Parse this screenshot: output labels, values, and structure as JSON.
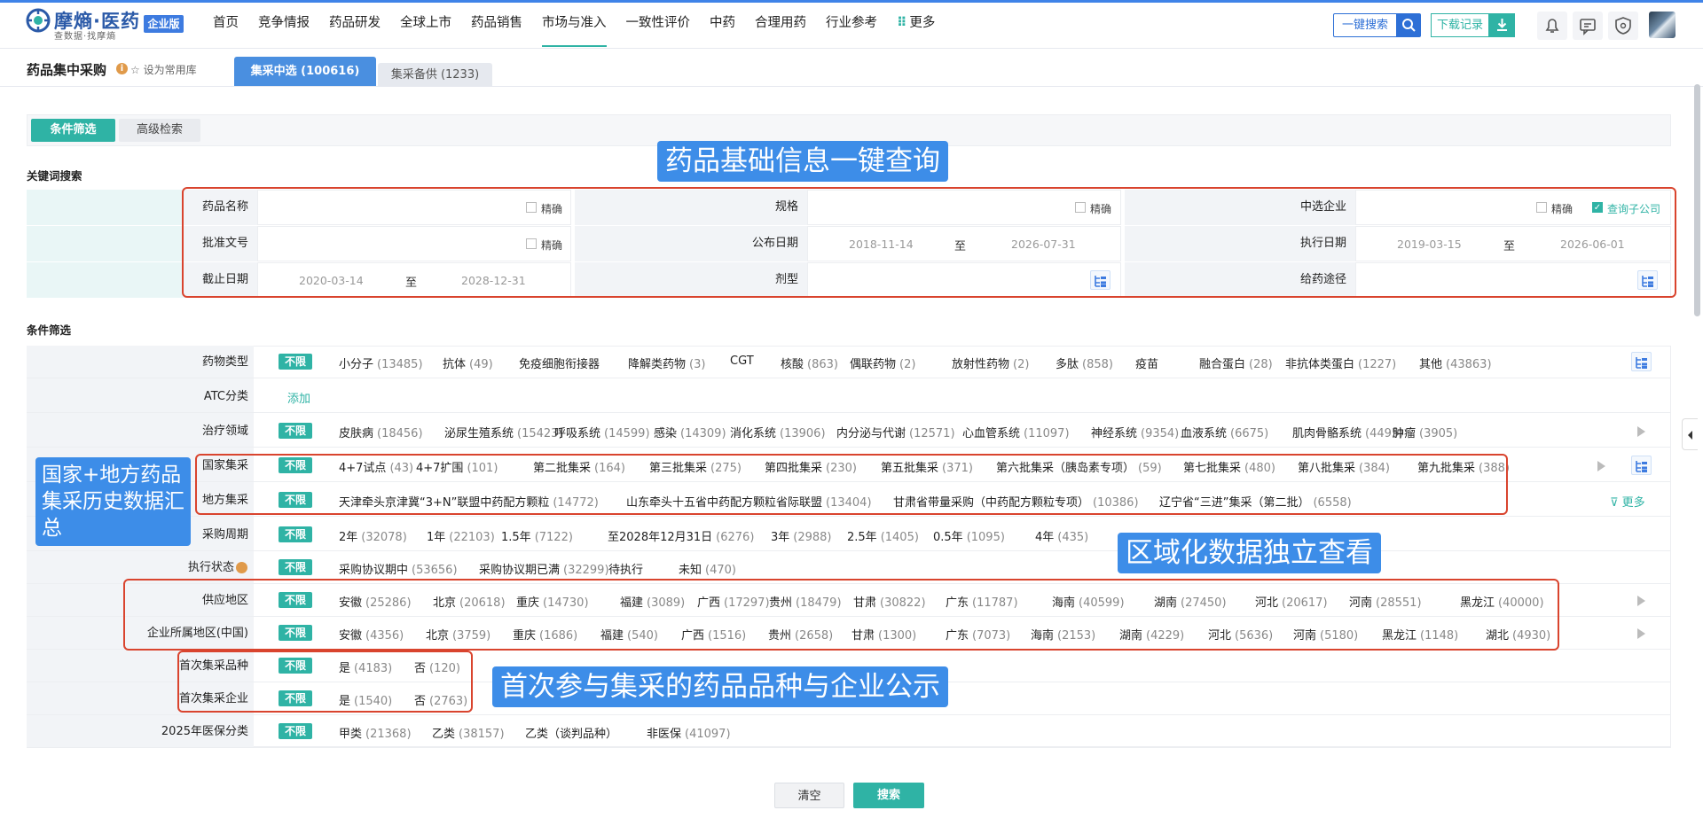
{
  "brand": {
    "name": "摩熵·医药",
    "tagline": "查数据·找摩熵",
    "edition": "企业版",
    "accent": "#2fb3a5",
    "blue": "#3d8de8"
  },
  "nav": {
    "items": [
      "首页",
      "竞争情报",
      "药品研发",
      "全球上市",
      "药品销售",
      "市场与准入",
      "一致性评价",
      "中药",
      "合理用药",
      "行业参考"
    ],
    "active": "市场与准入",
    "more": "更多"
  },
  "header": {
    "search_label": "一键搜索",
    "download_label": "下载记录"
  },
  "page": {
    "title": "药品集中采购",
    "fav_label": "设为常用库"
  },
  "tabs": {
    "selected": "集采中选 (100616)",
    "backup": "集采备供 (1233)"
  },
  "modes": {
    "filter": "条件筛选",
    "advanced": "高级检索"
  },
  "keyword": {
    "section_title": "关键词搜索",
    "exact": "精确",
    "to": "至",
    "sub_company": "查询子公司",
    "drug_name": "药品名称",
    "spec": "规格",
    "company": "中选企业",
    "approval_no": "批准文号",
    "publish_date": "公布日期",
    "exec_date": "执行日期",
    "deadline": "截止日期",
    "dosage_form": "剂型",
    "route": "给药途径",
    "publish_from": "2018-11-14",
    "publish_to": "2026-07-31",
    "exec_from": "2019-03-15",
    "exec_to": "2026-06-01",
    "deadline_from": "2020-03-14",
    "deadline_to": "2028-12-31"
  },
  "filter": {
    "section_title": "条件筛选",
    "unlimited": "不限",
    "add": "添加",
    "more": "更多",
    "rows": {
      "drug_type": {
        "label": "药物类型",
        "options": [
          {
            "name": "小分子",
            "count": "(13485)"
          },
          {
            "name": "抗体",
            "count": "(49)"
          },
          {
            "name": "免疫细胞衔接器",
            "count": ""
          },
          {
            "name": "降解类药物",
            "count": "(3)"
          },
          {
            "name": "CGT",
            "count": ""
          },
          {
            "name": "核酸",
            "count": "(863)"
          },
          {
            "name": "偶联药物",
            "count": "(2)"
          },
          {
            "name": "放射性药物",
            "count": "(2)"
          },
          {
            "name": "多肽",
            "count": "(858)"
          },
          {
            "name": "疫苗",
            "count": ""
          },
          {
            "name": "融合蛋白",
            "count": "(28)"
          },
          {
            "name": "非抗体类蛋白",
            "count": "(1227)"
          },
          {
            "name": "其他",
            "count": "(43863)"
          }
        ]
      },
      "atc": {
        "label": "ATC分类"
      },
      "therapy": {
        "label": "治疗领域",
        "options": [
          {
            "name": "皮肤病",
            "count": "(18456)"
          },
          {
            "name": "泌尿生殖系统",
            "count": "(15423)"
          },
          {
            "name": "呼吸系统",
            "count": "(14599)"
          },
          {
            "name": "感染",
            "count": "(14309)"
          },
          {
            "name": "消化系统",
            "count": "(13906)"
          },
          {
            "name": "内分泌与代谢",
            "count": "(12571)"
          },
          {
            "name": "心血管系统",
            "count": "(11097)"
          },
          {
            "name": "神经系统",
            "count": "(9354)"
          },
          {
            "name": "血液系统",
            "count": "(6675)"
          },
          {
            "name": "肌肉骨骼系统",
            "count": "(4495)"
          },
          {
            "name": "肿瘤",
            "count": "(3905)"
          }
        ]
      },
      "national": {
        "label": "国家集采",
        "options": [
          {
            "name": "4+7试点",
            "count": "(43)"
          },
          {
            "name": "4+7扩围",
            "count": "(101)"
          },
          {
            "name": "第二批集采",
            "count": "(164)"
          },
          {
            "name": "第三批集采",
            "count": "(275)"
          },
          {
            "name": "第四批集采",
            "count": "(230)"
          },
          {
            "name": "第五批集采",
            "count": "(371)"
          },
          {
            "name": "第六批集采（胰岛素专项）",
            "count": "(59)"
          },
          {
            "name": "第七批集采",
            "count": "(480)"
          },
          {
            "name": "第八批集采",
            "count": "(384)"
          },
          {
            "name": "第九批集采",
            "count": "(388)"
          }
        ]
      },
      "local": {
        "label": "地方集采",
        "options": [
          {
            "name": "天津牵头京津冀“3+N”联盟中药配方颗粒",
            "count": "(14772)"
          },
          {
            "name": "山东牵头十五省中药配方颗粒省际联盟",
            "count": "(13404)"
          },
          {
            "name": "甘肃省带量采购（中药配方颗粒专项）",
            "count": "(10386)"
          },
          {
            "name": "辽宁省“三进”集采（第二批）",
            "count": "(6558)"
          }
        ]
      },
      "period": {
        "label": "采购周期",
        "options": [
          {
            "name": "2年",
            "count": "(32078)"
          },
          {
            "name": "1年",
            "count": "(22103)"
          },
          {
            "name": "1.5年",
            "count": "(7122)"
          },
          {
            "name": "至2028年12月31日",
            "count": "(6276)"
          },
          {
            "name": "3年",
            "count": "(2988)"
          },
          {
            "name": "2.5年",
            "count": "(1405)"
          },
          {
            "name": "0.5年",
            "count": "(1095)"
          },
          {
            "name": "4年",
            "count": "(435)"
          }
        ]
      },
      "status": {
        "label": "执行状态",
        "options": [
          {
            "name": "采购协议期中",
            "count": "(53656)"
          },
          {
            "name": "采购协议期已满",
            "count": "(32299)"
          },
          {
            "name": "待执行",
            "count": ""
          },
          {
            "name": "未知",
            "count": "(470)"
          }
        ]
      },
      "supply_region": {
        "label": "供应地区",
        "options": [
          {
            "name": "安徽",
            "count": "(25286)"
          },
          {
            "name": "北京",
            "count": "(20618)"
          },
          {
            "name": "重庆",
            "count": "(14730)"
          },
          {
            "name": "福建",
            "count": "(3089)"
          },
          {
            "name": "广西",
            "count": "(17297)"
          },
          {
            "name": "贵州",
            "count": "(18479)"
          },
          {
            "name": "甘肃",
            "count": "(30822)"
          },
          {
            "name": "广东",
            "count": "(11787)"
          },
          {
            "name": "海南",
            "count": "(40599)"
          },
          {
            "name": "湖南",
            "count": "(27450)"
          },
          {
            "name": "河北",
            "count": "(20617)"
          },
          {
            "name": "河南",
            "count": "(28551)"
          },
          {
            "name": "黑龙江",
            "count": "(40000)"
          }
        ]
      },
      "company_region": {
        "label": "企业所属地区(中国)",
        "options": [
          {
            "name": "安徽",
            "count": "(4356)"
          },
          {
            "name": "北京",
            "count": "(3759)"
          },
          {
            "name": "重庆",
            "count": "(1686)"
          },
          {
            "name": "福建",
            "count": "(540)"
          },
          {
            "name": "广西",
            "count": "(1516)"
          },
          {
            "name": "贵州",
            "count": "(2658)"
          },
          {
            "name": "甘肃",
            "count": "(1300)"
          },
          {
            "name": "广东",
            "count": "(7073)"
          },
          {
            "name": "海南",
            "count": "(2153)"
          },
          {
            "name": "湖南",
            "count": "(4229)"
          },
          {
            "name": "河北",
            "count": "(5636)"
          },
          {
            "name": "河南",
            "count": "(5180)"
          },
          {
            "name": "黑龙江",
            "count": "(1148)"
          },
          {
            "name": "湖北",
            "count": "(4930)"
          }
        ]
      },
      "first_variety": {
        "label": "首次集采品种",
        "options": [
          {
            "name": "是",
            "count": "(4183)"
          },
          {
            "name": "否",
            "count": "(120)"
          }
        ]
      },
      "first_company": {
        "label": "首次集采企业",
        "options": [
          {
            "name": "是",
            "count": "(1540)"
          },
          {
            "name": "否",
            "count": "(2763)"
          }
        ]
      },
      "insurance": {
        "label": "2025年医保分类",
        "options": [
          {
            "name": "甲类",
            "count": "(21368)"
          },
          {
            "name": "乙类",
            "count": "(38157)"
          },
          {
            "name": "乙类（谈判品种）",
            "count": ""
          },
          {
            "name": "非医保",
            "count": "(41097)"
          }
        ]
      }
    }
  },
  "callouts": {
    "basic": "药品基础信息一键查询",
    "history": "国家+地方药品集采历史数据汇总",
    "region": "区域化数据独立查看",
    "first": "首次参与集采的药品品种与企业公示"
  },
  "actions": {
    "clear": "清空",
    "search": "搜索"
  }
}
